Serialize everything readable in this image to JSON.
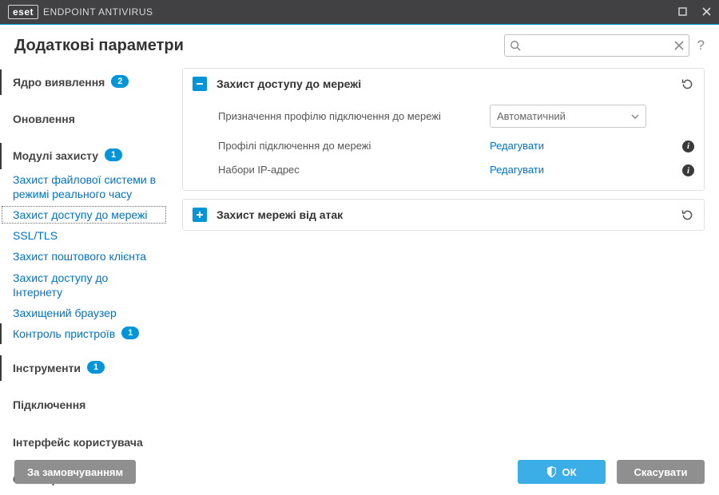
{
  "window": {
    "brand_mark": "eset",
    "brand_product": "ENDPOINT ANTIVIRUS"
  },
  "page_title": "Додаткові параметри",
  "search": {
    "placeholder": ""
  },
  "help_label": "?",
  "sidebar": {
    "items": [
      {
        "label": "Ядро виявлення",
        "badge": "2",
        "type": "group",
        "bar": true
      },
      {
        "label": "Оновлення",
        "type": "group"
      },
      {
        "label": "Модулі захисту",
        "badge": "1",
        "type": "group",
        "bar": true
      },
      {
        "label": "Захист файлової системи в режимі реального часу",
        "type": "link"
      },
      {
        "label": "Захист доступу до мережі",
        "type": "link",
        "selected": true
      },
      {
        "label": "SSL/TLS",
        "type": "link"
      },
      {
        "label": "Захист поштового клієнта",
        "type": "link"
      },
      {
        "label": "Захист доступу до Інтернету",
        "type": "link"
      },
      {
        "label": "Захищений браузер",
        "type": "link"
      },
      {
        "label": "Контроль пристроїв",
        "badge": "1",
        "type": "link",
        "bar": true
      },
      {
        "label": "Інструменти",
        "badge": "1",
        "type": "group",
        "bar": true
      },
      {
        "label": "Підключення",
        "type": "group"
      },
      {
        "label": "Інтерфейс користувача",
        "type": "group"
      },
      {
        "label": "Сповіщення",
        "type": "group"
      }
    ]
  },
  "panels": [
    {
      "title": "Захист доступу до мережі",
      "expanded": true,
      "rows": [
        {
          "label": "Призначення профілю підключення до мережі",
          "kind": "select",
          "value": "Автоматичний"
        },
        {
          "label": "Профілі підключення до мережі",
          "kind": "link",
          "action": "Редагувати",
          "info": true
        },
        {
          "label": "Набори ІР-адрес",
          "kind": "link",
          "action": "Редагувати",
          "info": true
        }
      ]
    },
    {
      "title": "Захист мережі від атак",
      "expanded": false
    }
  ],
  "footer": {
    "defaults": "За замовчуванням",
    "ok": "ОК",
    "cancel": "Скасувати"
  }
}
